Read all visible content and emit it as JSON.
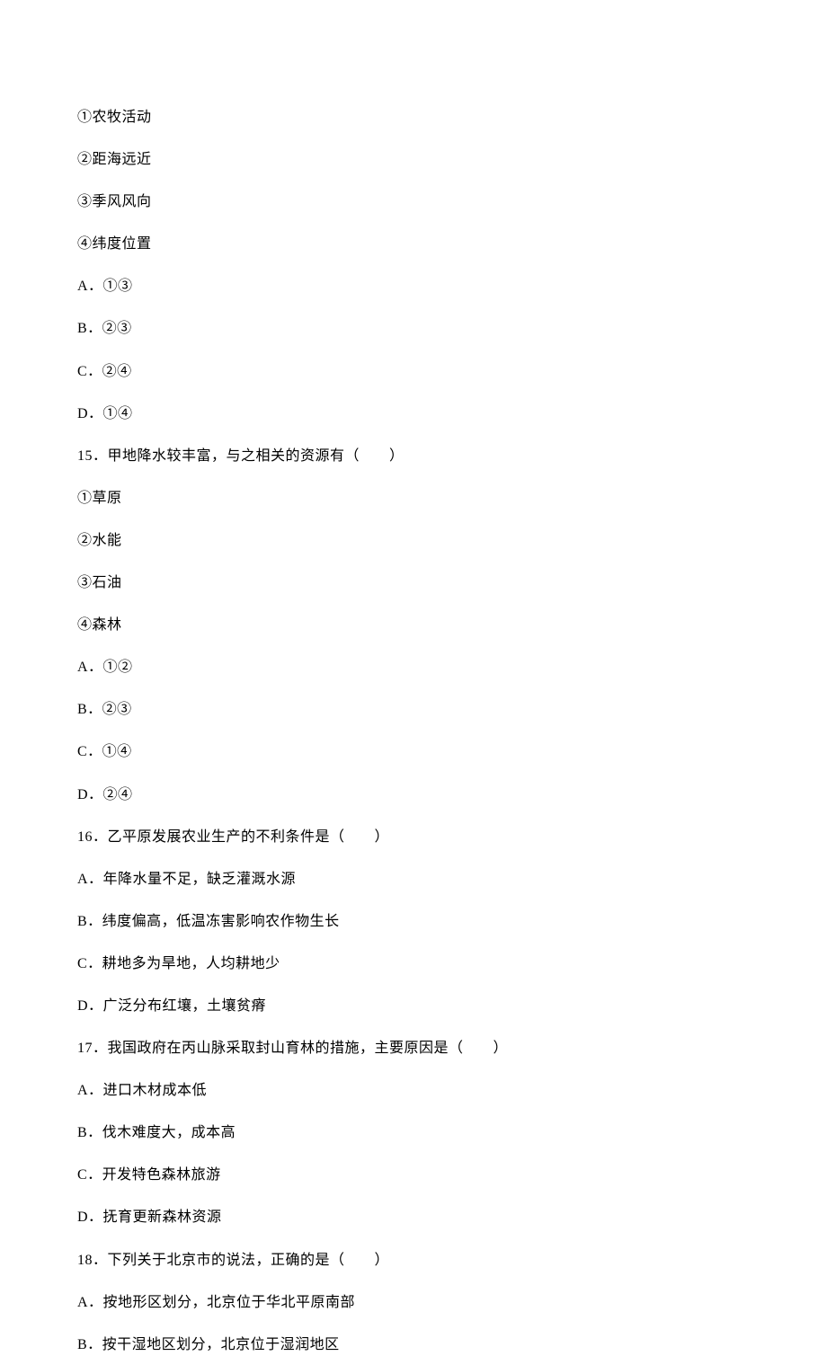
{
  "lines": [
    "①农牧活动",
    "②距海远近",
    "③季风风向",
    "④纬度位置",
    "A．①③",
    "B．②③",
    "C．②④",
    "D．①④",
    "15．甲地降水较丰富，与之相关的资源有（　　）",
    "①草原",
    "②水能",
    "③石油",
    "④森林",
    "A．①②",
    "B．②③",
    "C．①④",
    "D．②④",
    "16．乙平原发展农业生产的不利条件是（　　）",
    "A．年降水量不足，缺乏灌溉水源",
    "B．纬度偏高，低温冻害影响农作物生长",
    "C．耕地多为旱地，人均耕地少",
    "D．广泛分布红壤，土壤贫瘠",
    "17．我国政府在丙山脉采取封山育林的措施，主要原因是（　　）",
    "A．进口木材成本低",
    "B．伐木难度大，成本高",
    "C．开发特色森林旅游",
    "D．抚育更新森林资源",
    "18．下列关于北京市的说法，正确的是（　　）",
    "A．按地形区划分，北京位于华北平原南部",
    "B．按干湿地区划分，北京位于湿润地区"
  ]
}
